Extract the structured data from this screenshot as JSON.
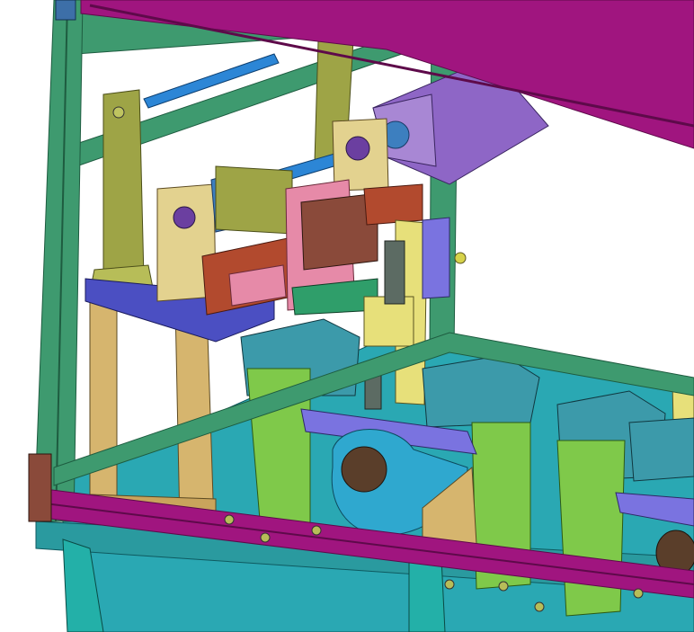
{
  "viewport": {
    "background": "#ffffff"
  },
  "colors": {
    "frame_green": "#3e9a6f",
    "frame_green_dark": "#1e5c40",
    "top_rail_magenta": "#a0157f",
    "top_rail_magenta_dark": "#5e0a4a",
    "table_top_teal": "#2aa8b3",
    "table_leg_teal": "#23b0a8",
    "column_green": "#7fc94a",
    "clamp_block_teal": "#3c9aaa",
    "motor_purple": "#8e66c6",
    "support_tan": "#d6b56e",
    "base_plate_blue": "#4b4fc2",
    "slide_block_red": "#b24a2e",
    "slide_rail_pink": "#e68aa8",
    "cylinder_gray": "#5c6b63",
    "bracket_olive": "#9ea446",
    "guide_rod_blue": "#2c86d6",
    "yellow_plate": "#e7e07a",
    "mount_brown": "#8a4a3a",
    "coupling_blue": "#3d7fbf",
    "ring_purple": "#6b3fa0",
    "gripper_brown": "#5a3e2a",
    "drum_cyan": "#2fa8cf",
    "violet_plate": "#7a73e0"
  },
  "icons": [
    "cad-assembly-icon"
  ]
}
